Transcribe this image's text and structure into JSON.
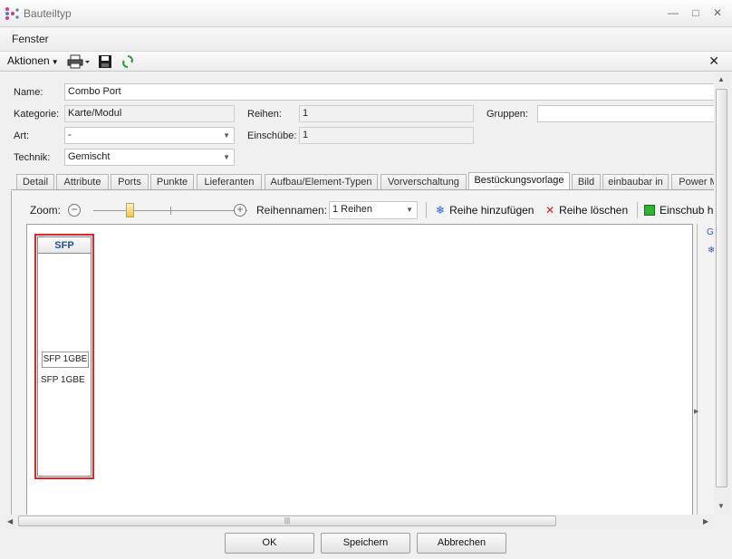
{
  "window": {
    "title": "Bauteiltyp"
  },
  "menu": {
    "fenster": "Fenster"
  },
  "toolbar": {
    "aktionen": "Aktionen"
  },
  "form": {
    "name_label": "Name:",
    "name_value": "Combo Port",
    "kategorie_label": "Kategorie:",
    "kategorie_value": "Karte/Modul",
    "reihen_label": "Reihen:",
    "reihen_value": "1",
    "gruppen_label": "Gruppen:",
    "gruppen_value": "",
    "art_label": "Art:",
    "art_value": "-",
    "einschuebe_label": "Einschübe:",
    "einschuebe_value": "1",
    "technik_label": "Technik:",
    "technik_value": "Gemischt"
  },
  "tabs": [
    {
      "label": "Detail"
    },
    {
      "label": "Attribute"
    },
    {
      "label": "Ports"
    },
    {
      "label": "Punkte"
    },
    {
      "label": "Lieferanten"
    },
    {
      "label": "Aufbau/Element-Typen"
    },
    {
      "label": "Vorverschaltung"
    },
    {
      "label": "Bestückungsvorlage"
    },
    {
      "label": "Bild"
    },
    {
      "label": "einbaubar in"
    },
    {
      "label": "Power M"
    }
  ],
  "editor": {
    "zoom_label": "Zoom:",
    "reihennamen_label": "Reihennamen:",
    "reihennamen_value": "1 Reihen",
    "add_row": "Reihe hinzufügen",
    "delete_row": "Reihe löschen",
    "insert_slot": "Einschub h",
    "rack_title": "SFP",
    "slot_box": "SFP 1GBE",
    "slot_text": "SFP 1GBE",
    "side_label": "Gr"
  },
  "buttons": {
    "ok": "OK",
    "save": "Speichern",
    "cancel": "Abbrechen"
  },
  "colors": {
    "highlight": "#e32424",
    "rack_title": "#1d4ea8"
  }
}
